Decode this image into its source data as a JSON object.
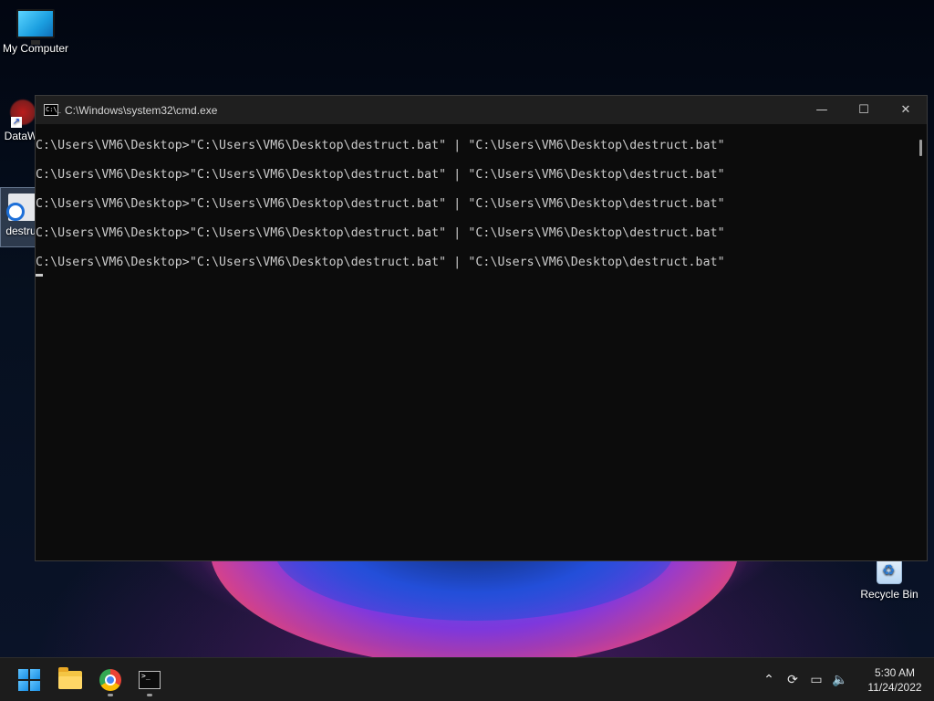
{
  "desktop": {
    "icons": {
      "my_computer": "My Computer",
      "dataw": "DataW",
      "destru": "destru",
      "recycle_bin": "Recycle Bin"
    }
  },
  "cmd_window": {
    "title": "C:\\Windows\\system32\\cmd.exe",
    "icon_text": "C:\\_",
    "controls": {
      "minimize": "—",
      "maximize": "☐",
      "close": "✕"
    },
    "lines": [
      "C:\\Users\\VM6\\Desktop>\"C:\\Users\\VM6\\Desktop\\destruct.bat\" | \"C:\\Users\\VM6\\Desktop\\destruct.bat\"",
      "C:\\Users\\VM6\\Desktop>\"C:\\Users\\VM6\\Desktop\\destruct.bat\" | \"C:\\Users\\VM6\\Desktop\\destruct.bat\"",
      "C:\\Users\\VM6\\Desktop>\"C:\\Users\\VM6\\Desktop\\destruct.bat\" | \"C:\\Users\\VM6\\Desktop\\destruct.bat\"",
      "C:\\Users\\VM6\\Desktop>\"C:\\Users\\VM6\\Desktop\\destruct.bat\" | \"C:\\Users\\VM6\\Desktop\\destruct.bat\"",
      "C:\\Users\\VM6\\Desktop>\"C:\\Users\\VM6\\Desktop\\destruct.bat\" | \"C:\\Users\\VM6\\Desktop\\destruct.bat\""
    ]
  },
  "taskbar": {
    "apps": [
      "start-icon",
      "file-explorer-icon",
      "chrome-icon",
      "terminal-icon"
    ],
    "tray": {
      "icons": [
        "chevron-up-icon",
        "sync-icon",
        "network-icon",
        "volume-icon"
      ],
      "time": "5:30 AM",
      "date": "11/24/2022"
    }
  }
}
